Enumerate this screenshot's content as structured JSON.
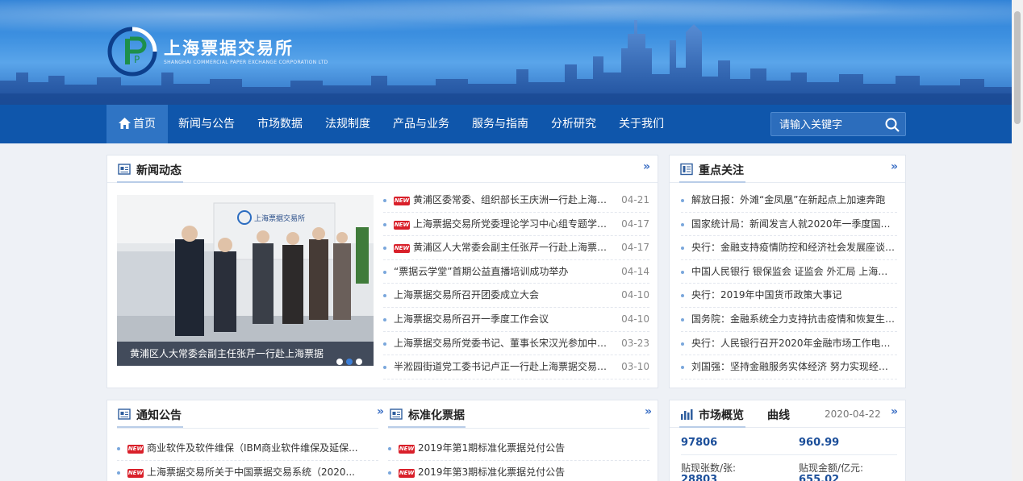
{
  "site": {
    "name_cn": "上海票据交易所",
    "name_en": "SHANGHAI COMMERCIAL PAPER EXCHANGE CORPORATION LTD",
    "logo_letters": "P"
  },
  "nav": {
    "items": [
      "首页",
      "新闻与公告",
      "市场数据",
      "法规制度",
      "产品与业务",
      "服务与指南",
      "分析研究",
      "关于我们"
    ],
    "search_placeholder": "请输入关键字"
  },
  "news": {
    "title": "新闻动态",
    "more": "»",
    "badge": "NEW",
    "photo_caption": "黄浦区人大常委会副主任张芹一行赴上海票据",
    "photo_sign": "上海票据交易所",
    "items": [
      {
        "title": "黄浦区委常委、组织部长王庆洲一行赴上海票据...",
        "date": "04-21",
        "new": true
      },
      {
        "title": "上海票据交易所党委理论学习中心组专题学习中...",
        "date": "04-17",
        "new": true
      },
      {
        "title": "黄浦区人大常委会副主任张芹一行赴上海票据交...",
        "date": "04-17",
        "new": true
      },
      {
        "title": "“票据云学堂”首期公益直播培训成功举办",
        "date": "04-14",
        "new": false
      },
      {
        "title": "上海票据交易所召开团委成立大会",
        "date": "04-10",
        "new": false
      },
      {
        "title": "上海票据交易所召开一季度工作会议",
        "date": "04-10",
        "new": false
      },
      {
        "title": "上海票据交易所党委书记、董事长宋汉光参加中办国...",
        "date": "03-23",
        "new": false
      },
      {
        "title": "半淞园街道党工委书记卢正一行赴上海票据交易所走访",
        "date": "03-10",
        "new": false
      }
    ]
  },
  "focus": {
    "title": "重点关注",
    "more": "»",
    "items": [
      "解放日报：外滩“金凤凰”在新起点上加速奔跑",
      "国家统计局：新闻发言人就2020年一季度国民...",
      "央行：金融支持疫情防控和经济社会发展座谈会...",
      "中国人民银行 银保监会 证监会 外汇局 上海市政...",
      "央行：2019年中国货币政策大事记",
      "国务院：金融系统全力支持抗击疫情和恢复生产...",
      "央行：人民银行召开2020年金融市场工作电视...",
      "刘国强：坚持金融服务实体经济 努力实现经济..."
    ]
  },
  "notice": {
    "title": "通知公告",
    "more": "»",
    "items": [
      "商业软件及软件维保（IBM商业软件维保及延保...",
      "上海票据交易所关于中国票据交易系统（2020..."
    ]
  },
  "standard": {
    "title": "标准化票据",
    "more": "»",
    "items": [
      "2019年第1期标准化票据兑付公告",
      "2019年第3期标准化票据兑付公告"
    ]
  },
  "market": {
    "title": "市场概览",
    "tab2": "曲线",
    "date": "2020-04-22",
    "more": "»",
    "value1": "97806",
    "value2": "960.99",
    "label1": "贴现张数/张:",
    "label2": "贴现金额/亿元:",
    "value3": "28803",
    "value4": "655.02"
  },
  "colors": {
    "nav_bg": "#0f56ab",
    "nav_active": "#2f74c4",
    "accent": "#3b6fc5",
    "new_badge": "#d9202a"
  }
}
